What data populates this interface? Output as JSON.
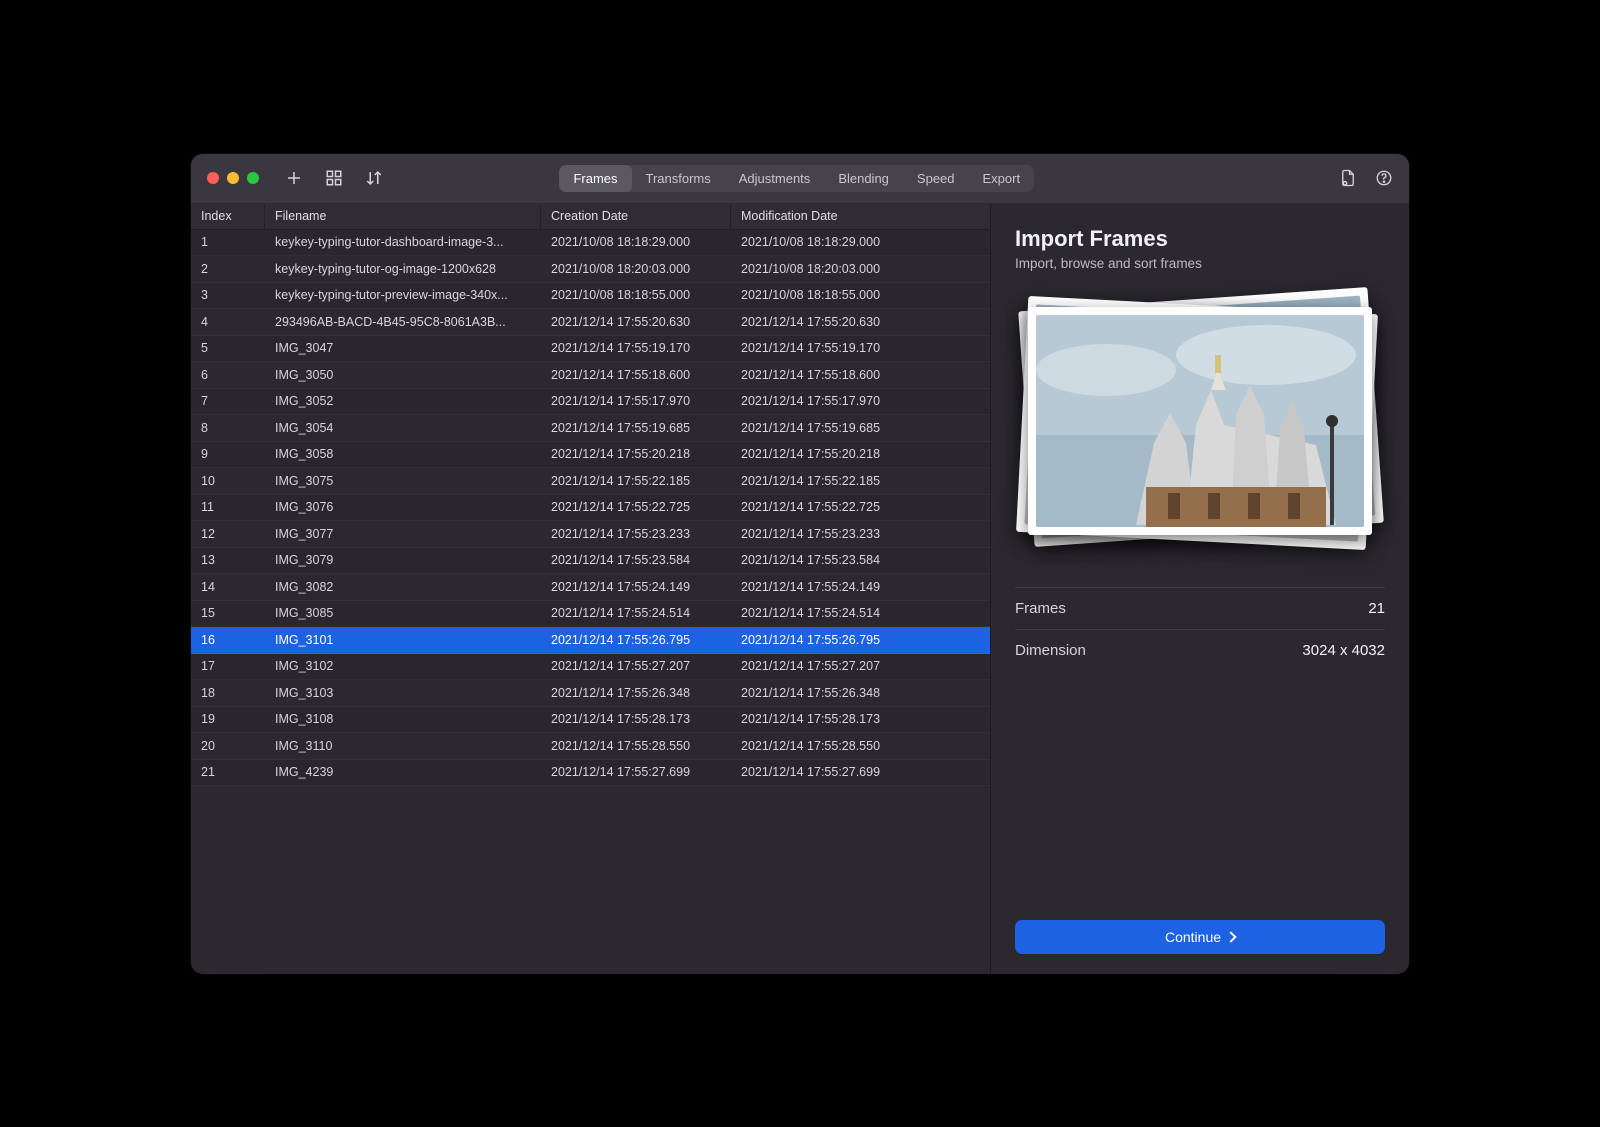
{
  "toolbar": {
    "tabs": [
      "Frames",
      "Transforms",
      "Adjustments",
      "Blending",
      "Speed",
      "Export"
    ],
    "active_tab": 0
  },
  "columns": {
    "index": "Index",
    "filename": "Filename",
    "created": "Creation Date",
    "modified": "Modification Date"
  },
  "rows": [
    {
      "index": "1",
      "filename": "keykey-typing-tutor-dashboard-image-3...",
      "created": "2021/10/08 18:18:29.000",
      "modified": "2021/10/08 18:18:29.000"
    },
    {
      "index": "2",
      "filename": "keykey-typing-tutor-og-image-1200x628",
      "created": "2021/10/08 18:20:03.000",
      "modified": "2021/10/08 18:20:03.000"
    },
    {
      "index": "3",
      "filename": "keykey-typing-tutor-preview-image-340x...",
      "created": "2021/10/08 18:18:55.000",
      "modified": "2021/10/08 18:18:55.000"
    },
    {
      "index": "4",
      "filename": "293496AB-BACD-4B45-95C8-8061A3B...",
      "created": "2021/12/14 17:55:20.630",
      "modified": "2021/12/14 17:55:20.630"
    },
    {
      "index": "5",
      "filename": "IMG_3047",
      "created": "2021/12/14 17:55:19.170",
      "modified": "2021/12/14 17:55:19.170"
    },
    {
      "index": "6",
      "filename": "IMG_3050",
      "created": "2021/12/14 17:55:18.600",
      "modified": "2021/12/14 17:55:18.600"
    },
    {
      "index": "7",
      "filename": "IMG_3052",
      "created": "2021/12/14 17:55:17.970",
      "modified": "2021/12/14 17:55:17.970"
    },
    {
      "index": "8",
      "filename": "IMG_3054",
      "created": "2021/12/14 17:55:19.685",
      "modified": "2021/12/14 17:55:19.685"
    },
    {
      "index": "9",
      "filename": "IMG_3058",
      "created": "2021/12/14 17:55:20.218",
      "modified": "2021/12/14 17:55:20.218"
    },
    {
      "index": "10",
      "filename": "IMG_3075",
      "created": "2021/12/14 17:55:22.185",
      "modified": "2021/12/14 17:55:22.185"
    },
    {
      "index": "11",
      "filename": "IMG_3076",
      "created": "2021/12/14 17:55:22.725",
      "modified": "2021/12/14 17:55:22.725"
    },
    {
      "index": "12",
      "filename": "IMG_3077",
      "created": "2021/12/14 17:55:23.233",
      "modified": "2021/12/14 17:55:23.233"
    },
    {
      "index": "13",
      "filename": "IMG_3079",
      "created": "2021/12/14 17:55:23.584",
      "modified": "2021/12/14 17:55:23.584"
    },
    {
      "index": "14",
      "filename": "IMG_3082",
      "created": "2021/12/14 17:55:24.149",
      "modified": "2021/12/14 17:55:24.149"
    },
    {
      "index": "15",
      "filename": "IMG_3085",
      "created": "2021/12/14 17:55:24.514",
      "modified": "2021/12/14 17:55:24.514"
    },
    {
      "index": "16",
      "filename": "IMG_3101",
      "created": "2021/12/14 17:55:26.795",
      "modified": "2021/12/14 17:55:26.795",
      "selected": true
    },
    {
      "index": "17",
      "filename": "IMG_3102",
      "created": "2021/12/14 17:55:27.207",
      "modified": "2021/12/14 17:55:27.207"
    },
    {
      "index": "18",
      "filename": "IMG_3103",
      "created": "2021/12/14 17:55:26.348",
      "modified": "2021/12/14 17:55:26.348"
    },
    {
      "index": "19",
      "filename": "IMG_3108",
      "created": "2021/12/14 17:55:28.173",
      "modified": "2021/12/14 17:55:28.173"
    },
    {
      "index": "20",
      "filename": "IMG_3110",
      "created": "2021/12/14 17:55:28.550",
      "modified": "2021/12/14 17:55:28.550"
    },
    {
      "index": "21",
      "filename": "IMG_4239",
      "created": "2021/12/14 17:55:27.699",
      "modified": "2021/12/14 17:55:27.699"
    }
  ],
  "panel": {
    "title": "Import Frames",
    "subtitle": "Import, browse and sort frames",
    "frames_label": "Frames",
    "frames_value": "21",
    "dimension_label": "Dimension",
    "dimension_value": "3024 x 4032",
    "continue_label": "Continue"
  }
}
